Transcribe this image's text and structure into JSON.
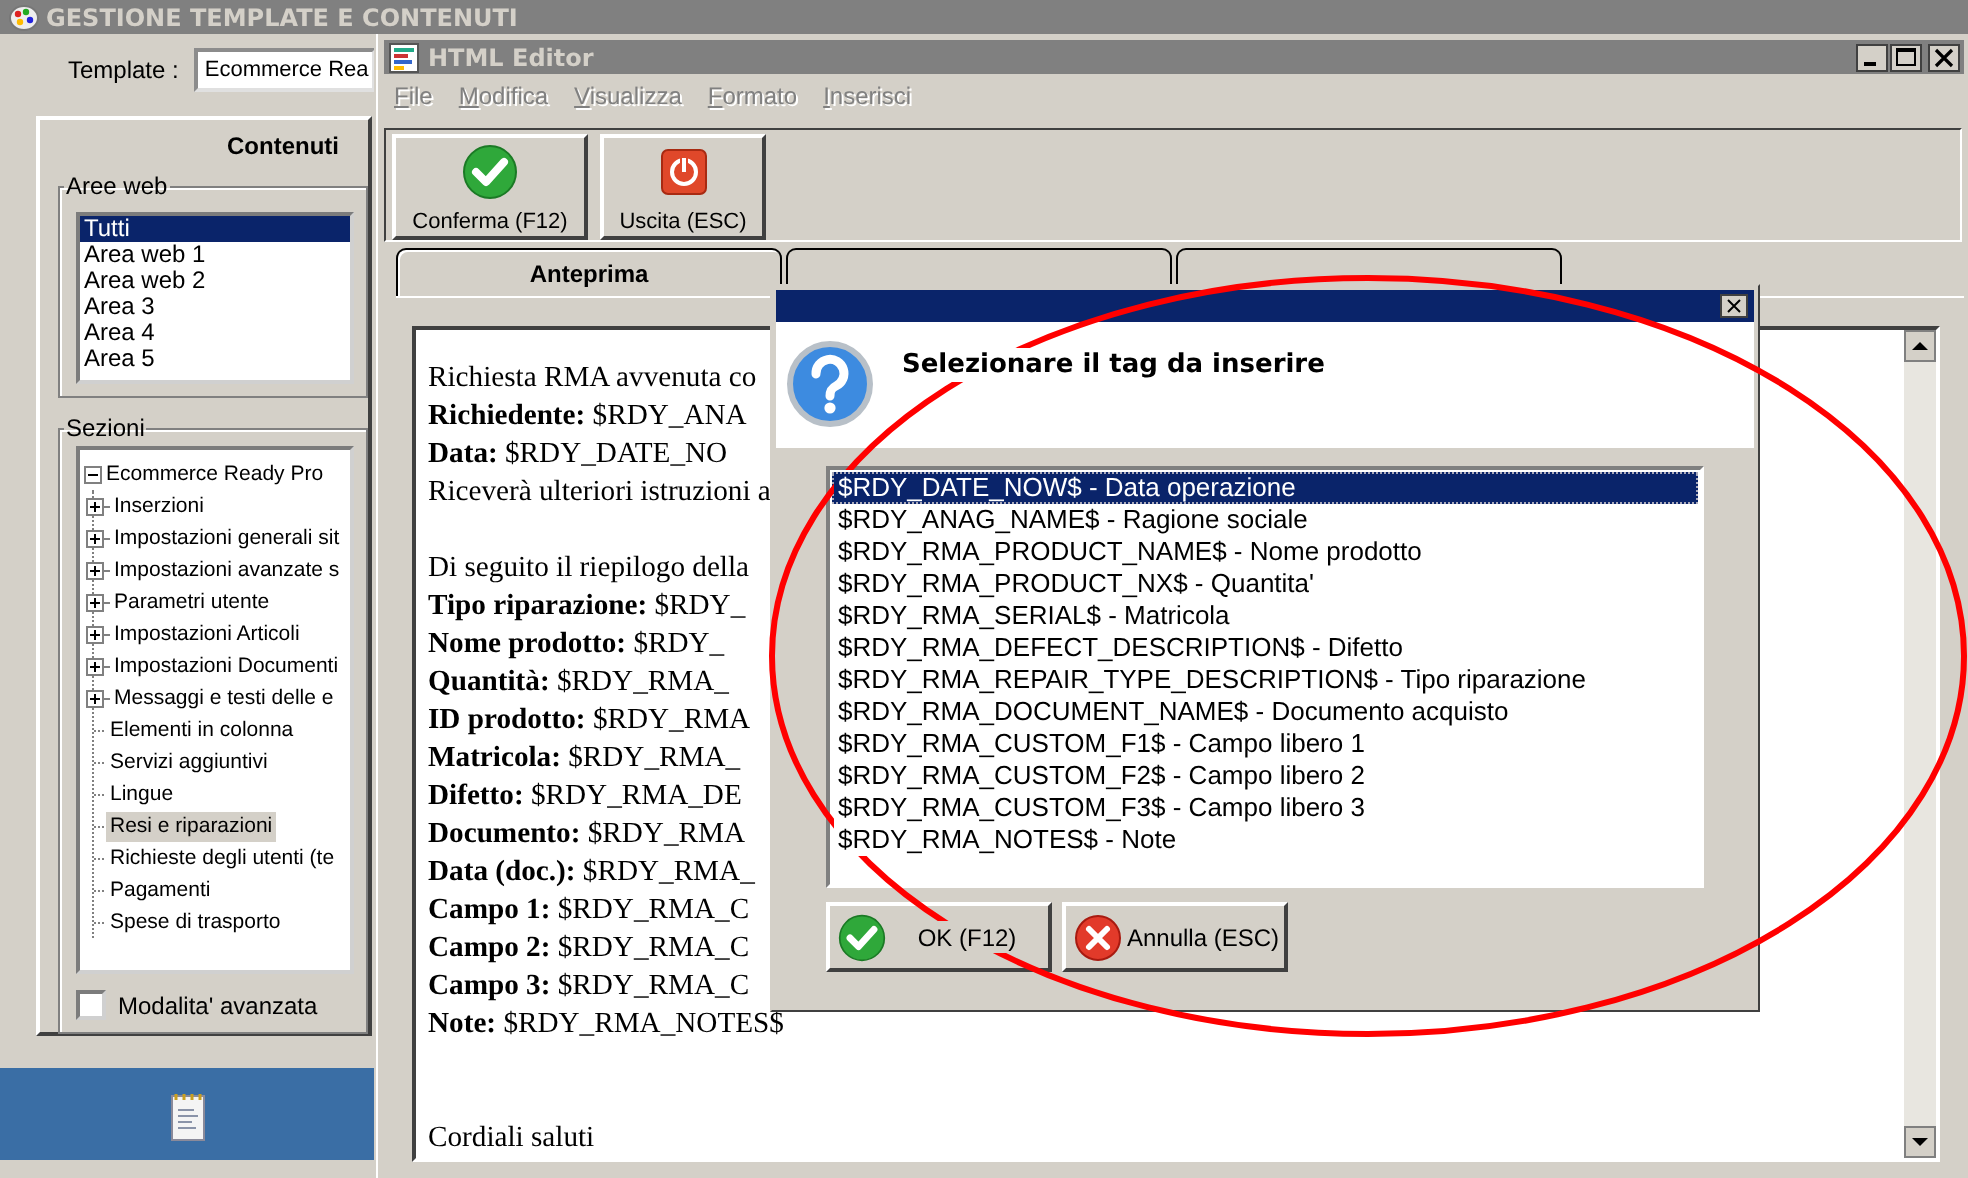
{
  "main_window": {
    "title": "GESTIONE TEMPLATE E CONTENUTI",
    "template_label": "Template :",
    "template_value": "Ecommerce Rea",
    "panel_title": "Contenuti",
    "areas": {
      "label": "Aree web",
      "items": [
        {
          "label": "Tutti",
          "selected": true
        },
        {
          "label": "Area web 1",
          "selected": false
        },
        {
          "label": "Area web 2",
          "selected": false
        },
        {
          "label": "Area 3",
          "selected": false
        },
        {
          "label": "Area 4",
          "selected": false
        },
        {
          "label": "Area 5",
          "selected": false
        }
      ]
    },
    "sections": {
      "label": "Sezioni",
      "tree": [
        {
          "label": "Ecommerce Ready Pro",
          "expanded": true,
          "selected": false,
          "children": [
            {
              "label": "Inserzioni",
              "expanded": false,
              "selected": false
            },
            {
              "label": "Impostazioni generali sit",
              "expanded": false,
              "selected": false
            },
            {
              "label": "Impostazioni avanzate s",
              "expanded": false,
              "selected": false
            },
            {
              "label": "Parametri utente",
              "expanded": false,
              "selected": false
            },
            {
              "label": "Impostazioni Articoli",
              "expanded": false,
              "selected": false
            },
            {
              "label": "Impostazioni Documenti",
              "expanded": false,
              "selected": false
            },
            {
              "label": "Messaggi e testi delle e",
              "expanded": false,
              "selected": false
            },
            {
              "label": "Elementi in colonna",
              "selected": false
            },
            {
              "label": "Servizi aggiuntivi",
              "selected": false
            },
            {
              "label": "Lingue",
              "selected": false
            },
            {
              "label": "Resi e riparazioni",
              "selected": true
            },
            {
              "label": "Richieste degli utenti (te",
              "selected": false
            },
            {
              "label": "Pagamenti",
              "selected": false
            },
            {
              "label": "Spese di trasporto",
              "selected": false
            }
          ]
        }
      ]
    },
    "advanced": {
      "label": "Modalita' avanzata",
      "checked": false
    }
  },
  "editor": {
    "title": "HTML Editor",
    "menu": [
      {
        "label": "File",
        "disabled": true
      },
      {
        "label": "Modifica",
        "disabled": true
      },
      {
        "label": "Visualizza",
        "disabled": true
      },
      {
        "label": "Formato",
        "disabled": true
      },
      {
        "label": "Inserisci",
        "disabled": true
      }
    ],
    "toolbar": [
      {
        "label": "Conferma (F12)",
        "kind": "confirm"
      },
      {
        "label": "Uscita (ESC)",
        "kind": "exit"
      }
    ],
    "tabs": [
      {
        "label": "Anteprima",
        "selected": true
      },
      {
        "selected": false
      },
      {
        "selected": false
      }
    ],
    "preview_lines": [
      {
        "kind": "text",
        "text": "Richiesta RMA avvenuta co"
      },
      {
        "kind": "text",
        "text": "**Richiedente:** $RDY_ANA"
      },
      {
        "kind": "text",
        "text": "**Data:** $RDY_DATE_NO"
      },
      {
        "kind": "text",
        "text": "Riceverà ulteriori istruzioni a"
      },
      {
        "kind": "blank"
      },
      {
        "kind": "text",
        "text": "Di seguito il riepilogo della"
      },
      {
        "kind": "text",
        "text": "**Tipo riparazione:** $RDY_"
      },
      {
        "kind": "text",
        "text": "**Nome prodotto:** $RDY_"
      },
      {
        "kind": "text",
        "text": "**Quantità:** $RDY_RMA_"
      },
      {
        "kind": "text",
        "text": "**ID prodotto:** $RDY_RMA"
      },
      {
        "kind": "text",
        "text": "**Matricola:** $RDY_RMA_"
      },
      {
        "kind": "text",
        "text": "**Difetto:** $RDY_RMA_DE"
      },
      {
        "kind": "text",
        "text": "**Documento:** $RDY_RMA"
      },
      {
        "kind": "text",
        "text": "**Data (doc.):** $RDY_RMA_"
      },
      {
        "kind": "text",
        "text": "**Campo 1:** $RDY_RMA_C"
      },
      {
        "kind": "text",
        "text": "**Campo 2:** $RDY_RMA_C"
      },
      {
        "kind": "text",
        "text": "**Campo 3:** $RDY_RMA_C"
      },
      {
        "kind": "text",
        "text": "**Note:** $RDY_RMA_NOTES$"
      },
      {
        "kind": "blank"
      },
      {
        "kind": "blank"
      },
      {
        "kind": "text",
        "text": "Cordiali saluti"
      }
    ]
  },
  "dialog": {
    "title": "Selezionare il tag da inserire",
    "tags": [
      {
        "label": "$RDY_DATE_NOW$ - Data operazione",
        "selected": true
      },
      {
        "label": "$RDY_ANAG_NAME$ - Ragione sociale",
        "selected": false
      },
      {
        "label": "$RDY_RMA_PRODUCT_NAME$ - Nome prodotto",
        "selected": false
      },
      {
        "label": "$RDY_RMA_PRODUCT_NX$ - Quantita'",
        "selected": false
      },
      {
        "label": "$RDY_RMA_SERIAL$ - Matricola",
        "selected": false
      },
      {
        "label": "$RDY_RMA_DEFECT_DESCRIPTION$ - Difetto",
        "selected": false
      },
      {
        "label": "$RDY_RMA_REPAIR_TYPE_DESCRIPTION$ - Tipo riparazione",
        "selected": false
      },
      {
        "label": "$RDY_RMA_DOCUMENT_NAME$ - Documento acquisto",
        "selected": false
      },
      {
        "label": "$RDY_RMA_CUSTOM_F1$ - Campo libero 1",
        "selected": false
      },
      {
        "label": "$RDY_RMA_CUSTOM_F2$ - Campo libero 2",
        "selected": false
      },
      {
        "label": "$RDY_RMA_CUSTOM_F3$ - Campo libero 3",
        "selected": false
      },
      {
        "label": "$RDY_RMA_NOTES$ - Note",
        "selected": false
      }
    ],
    "buttons": [
      {
        "label": "OK (F12)",
        "kind": "ok"
      },
      {
        "label": "Annulla (ESC)",
        "kind": "cancel"
      }
    ]
  },
  "annotation": {
    "kind": "ellipse"
  }
}
